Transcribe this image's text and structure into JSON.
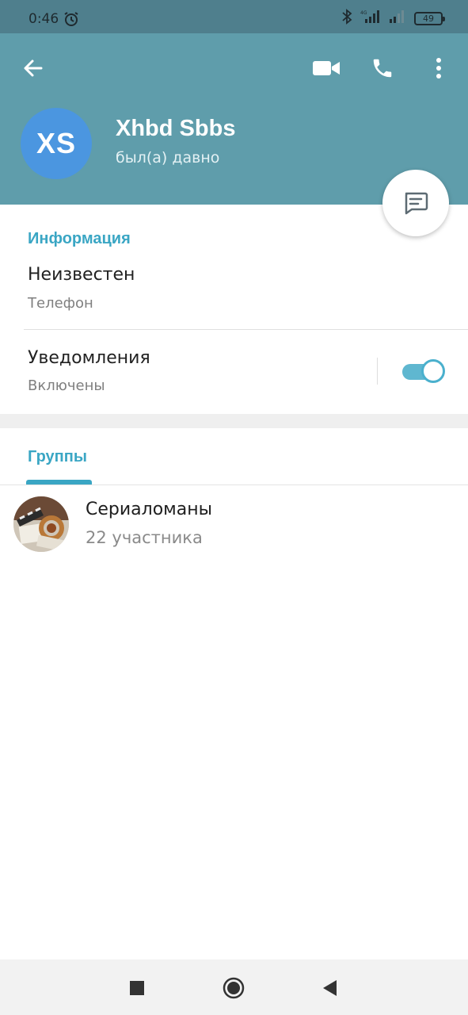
{
  "status_bar": {
    "time": "0:46",
    "battery": "49",
    "network": "4G"
  },
  "header": {
    "avatar_initials": "XS",
    "name": "Xhbd Sbbs",
    "last_seen": "был(а) давно"
  },
  "info": {
    "section_title": "Информация",
    "phone_value": "Неизвестен",
    "phone_label": "Телефон",
    "notifications_label": "Уведомления",
    "notifications_value": "Включены",
    "notifications_on": true
  },
  "groups": {
    "tab_label": "Группы",
    "items": [
      {
        "name": "Сериаломаны",
        "members": "22 участника"
      }
    ]
  },
  "colors": {
    "header_bg": "#5f9dab",
    "status_bg": "#4f7f8d",
    "accent": "#3aa6c4",
    "avatar_bg": "#4b96e0"
  },
  "icons": [
    "alarm-icon",
    "bluetooth-icon",
    "signal-icon",
    "battery-icon",
    "back-arrow-icon",
    "video-call-icon",
    "phone-icon",
    "more-vert-icon",
    "message-icon",
    "nav-recents-icon",
    "nav-home-icon",
    "nav-back-icon"
  ]
}
